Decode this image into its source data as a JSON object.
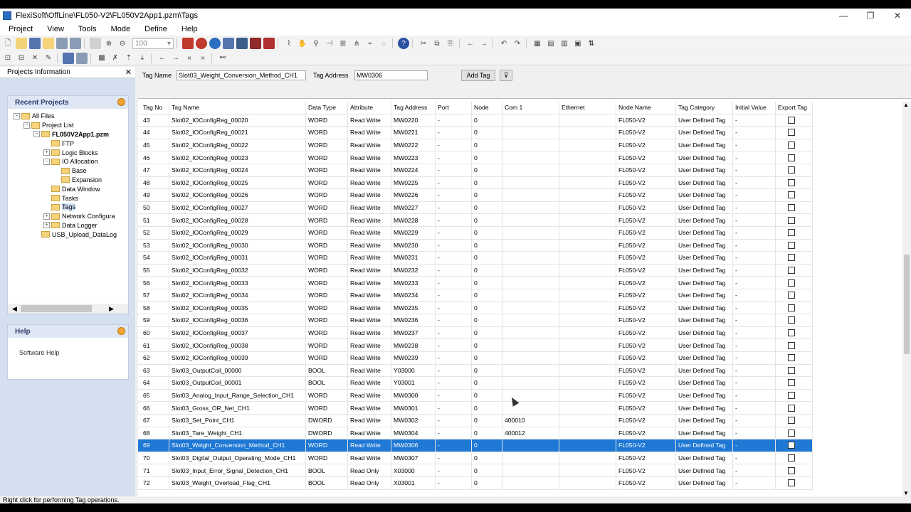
{
  "window": {
    "title": "FlexiSoft\\OffLine\\FL050-V2\\FL050V2App1.pzm\\Tags",
    "minimize_glyph": "—",
    "maximize_glyph": "❐",
    "close_glyph": "✕"
  },
  "menu": [
    "Project",
    "View",
    "Tools",
    "Mode",
    "Define",
    "Help"
  ],
  "toolbar": {
    "zoom_value": "100"
  },
  "left_panel": {
    "header": "Projects Information",
    "close_glyph": "✕",
    "recent_projects": {
      "title": "Recent Projects",
      "tree": [
        {
          "label": "All Files",
          "level": 0,
          "exp": "−"
        },
        {
          "label": "Project List",
          "level": 1,
          "exp": "−"
        },
        {
          "label": "FL050V2App1.pzm",
          "level": 2,
          "exp": "−",
          "bold": true
        },
        {
          "label": "FTP",
          "level": 3,
          "exp": ""
        },
        {
          "label": "Logic Blocks",
          "level": 3,
          "exp": "+"
        },
        {
          "label": "IO Allocation",
          "level": 3,
          "exp": "−"
        },
        {
          "label": "Base",
          "level": 4,
          "exp": ""
        },
        {
          "label": "Expansion",
          "level": 4,
          "exp": ""
        },
        {
          "label": "Data Window",
          "level": 3,
          "exp": ""
        },
        {
          "label": "Tasks",
          "level": 3,
          "exp": ""
        },
        {
          "label": "Tags",
          "level": 3,
          "exp": "",
          "selected": true
        },
        {
          "label": "Network Configura",
          "level": 3,
          "exp": "+"
        },
        {
          "label": "Data Logger",
          "level": 3,
          "exp": "+"
        },
        {
          "label": "USB_Upload_DataLog",
          "level": 2,
          "exp": ""
        }
      ]
    },
    "help": {
      "title": "Help",
      "link": "Software Help"
    }
  },
  "tag_bar": {
    "tag_name_label": "Tag Name",
    "tag_name_value": "Slot03_Weight_Conversion_Method_CH1",
    "tag_address_label": "Tag Address",
    "tag_address_value": "MW0306",
    "add_button": "Add Tag",
    "filter_glyph": "⊽"
  },
  "grid": {
    "columns": [
      "Tag No",
      "Tag Name",
      "Data Type",
      "Attribute",
      "Tag Address",
      "Port",
      "Node",
      "Com 1",
      "Ethernet",
      "Node Name",
      "Tag Category",
      "Initial Value",
      "Export Tag"
    ],
    "selected_tag_no": "69",
    "rows": [
      [
        "43",
        "Slot02_IOConfigReg_00020",
        "WORD",
        "Read Write",
        "MW0220",
        "-",
        "0",
        "",
        "",
        "FL050-V2",
        "User Defined Tag",
        "-"
      ],
      [
        "44",
        "Slot02_IOConfigReg_00021",
        "WORD",
        "Read Write",
        "MW0221",
        "-",
        "0",
        "",
        "",
        "FL050-V2",
        "User Defined Tag",
        "-"
      ],
      [
        "45",
        "Slot02_IOConfigReg_00022",
        "WORD",
        "Read Write",
        "MW0222",
        "-",
        "0",
        "",
        "",
        "FL050-V2",
        "User Defined Tag",
        "-"
      ],
      [
        "46",
        "Slot02_IOConfigReg_00023",
        "WORD",
        "Read Write",
        "MW0223",
        "-",
        "0",
        "",
        "",
        "FL050-V2",
        "User Defined Tag",
        "-"
      ],
      [
        "47",
        "Slot02_IOConfigReg_00024",
        "WORD",
        "Read Write",
        "MW0224",
        "-",
        "0",
        "",
        "",
        "FL050-V2",
        "User Defined Tag",
        "-"
      ],
      [
        "48",
        "Slot02_IOConfigReg_00025",
        "WORD",
        "Read Write",
        "MW0225",
        "-",
        "0",
        "",
        "",
        "FL050-V2",
        "User Defined Tag",
        "-"
      ],
      [
        "49",
        "Slot02_IOConfigReg_00026",
        "WORD",
        "Read Write",
        "MW0226",
        "-",
        "0",
        "",
        "",
        "FL050-V2",
        "User Defined Tag",
        "-"
      ],
      [
        "50",
        "Slot02_IOConfigReg_00027",
        "WORD",
        "Read Write",
        "MW0227",
        "-",
        "0",
        "",
        "",
        "FL050-V2",
        "User Defined Tag",
        "-"
      ],
      [
        "51",
        "Slot02_IOConfigReg_00028",
        "WORD",
        "Read Write",
        "MW0228",
        "-",
        "0",
        "",
        "",
        "FL050-V2",
        "User Defined Tag",
        "-"
      ],
      [
        "52",
        "Slot02_IOConfigReg_00029",
        "WORD",
        "Read Write",
        "MW0229",
        "-",
        "0",
        "",
        "",
        "FL050-V2",
        "User Defined Tag",
        "-"
      ],
      [
        "53",
        "Slot02_IOConfigReg_00030",
        "WORD",
        "Read Write",
        "MW0230",
        "-",
        "0",
        "",
        "",
        "FL050-V2",
        "User Defined Tag",
        "-"
      ],
      [
        "54",
        "Slot02_IOConfigReg_00031",
        "WORD",
        "Read Write",
        "MW0231",
        "-",
        "0",
        "",
        "",
        "FL050-V2",
        "User Defined Tag",
        "-"
      ],
      [
        "55",
        "Slot02_IOConfigReg_00032",
        "WORD",
        "Read Write",
        "MW0232",
        "-",
        "0",
        "",
        "",
        "FL050-V2",
        "User Defined Tag",
        "-"
      ],
      [
        "56",
        "Slot02_IOConfigReg_00033",
        "WORD",
        "Read Write",
        "MW0233",
        "-",
        "0",
        "",
        "",
        "FL050-V2",
        "User Defined Tag",
        "-"
      ],
      [
        "57",
        "Slot02_IOConfigReg_00034",
        "WORD",
        "Read Write",
        "MW0234",
        "-",
        "0",
        "",
        "",
        "FL050-V2",
        "User Defined Tag",
        "-"
      ],
      [
        "58",
        "Slot02_IOConfigReg_00035",
        "WORD",
        "Read Write",
        "MW0235",
        "-",
        "0",
        "",
        "",
        "FL050-V2",
        "User Defined Tag",
        "-"
      ],
      [
        "59",
        "Slot02_IOConfigReg_00036",
        "WORD",
        "Read Write",
        "MW0236",
        "-",
        "0",
        "",
        "",
        "FL050-V2",
        "User Defined Tag",
        "-"
      ],
      [
        "60",
        "Slot02_IOConfigReg_00037",
        "WORD",
        "Read Write",
        "MW0237",
        "-",
        "0",
        "",
        "",
        "FL050-V2",
        "User Defined Tag",
        "-"
      ],
      [
        "61",
        "Slot02_IOConfigReg_00038",
        "WORD",
        "Read Write",
        "MW0238",
        "-",
        "0",
        "",
        "",
        "FL050-V2",
        "User Defined Tag",
        "-"
      ],
      [
        "62",
        "Slot02_IOConfigReg_00039",
        "WORD",
        "Read Write",
        "MW0239",
        "-",
        "0",
        "",
        "",
        "FL050-V2",
        "User Defined Tag",
        "-"
      ],
      [
        "63",
        "Slot03_OutputCoil_00000",
        "BOOL",
        "Read Write",
        "Y03000",
        "-",
        "0",
        "",
        "",
        "FL050-V2",
        "User Defined Tag",
        "-"
      ],
      [
        "64",
        "Slot03_OutputCoil_00001",
        "BOOL",
        "Read Write",
        "Y03001",
        "-",
        "0",
        "",
        "",
        "FL050-V2",
        "User Defined Tag",
        "-"
      ],
      [
        "65",
        "Slot03_Analog_Input_Range_Selection_CH1",
        "WORD",
        "Read Write",
        "MW0300",
        "-",
        "0",
        "",
        "",
        "FL050-V2",
        "User Defined Tag",
        "-"
      ],
      [
        "66",
        "Slot03_Gross_OR_Net_CH1",
        "WORD",
        "Read Write",
        "MW0301",
        "-",
        "0",
        "",
        "",
        "FL050-V2",
        "User Defined Tag",
        "-"
      ],
      [
        "67",
        "Slot03_Set_Point_CH1",
        "DWORD",
        "Read Write",
        "MW0302",
        "-",
        "0",
        "400010",
        "",
        "FL050-V2",
        "User Defined Tag",
        "-"
      ],
      [
        "68",
        "Slot03_Tare_Weight_CH1",
        "DWORD",
        "Read Write",
        "MW0304",
        "-",
        "0",
        "400012",
        "",
        "FL050-V2",
        "User Defined Tag",
        "-"
      ],
      [
        "69",
        "Slot03_Weight_Conversion_Method_CH1",
        "WORD",
        "Read Write",
        "MW0306",
        "-",
        "0",
        "",
        "",
        "FL050-V2",
        "User Defined Tag",
        "-"
      ],
      [
        "70",
        "Slot03_Digital_Output_Operating_Mode_CH1",
        "WORD",
        "Read Write",
        "MW0307",
        "-",
        "0",
        "",
        "",
        "FL050-V2",
        "User Defined Tag",
        "-"
      ],
      [
        "71",
        "Slot03_Input_Error_Signal_Detection_CH1",
        "BOOL",
        "Read Only",
        "X03000",
        "-",
        "0",
        "",
        "",
        "FL050-V2",
        "User Defined Tag",
        "-"
      ],
      [
        "72",
        "Slot03_Weight_Overload_Flag_CH1",
        "BOOL",
        "Read Only",
        "X03001",
        "-",
        "0",
        "",
        "",
        "FL050-V2",
        "User Defined Tag",
        "-"
      ]
    ]
  },
  "status_bar": {
    "text": "Right click for performing Tag operations."
  },
  "colors": {
    "selection": "#1e78d4",
    "panel_bg": "#d4dff0",
    "pane_button": "#f2a533"
  }
}
